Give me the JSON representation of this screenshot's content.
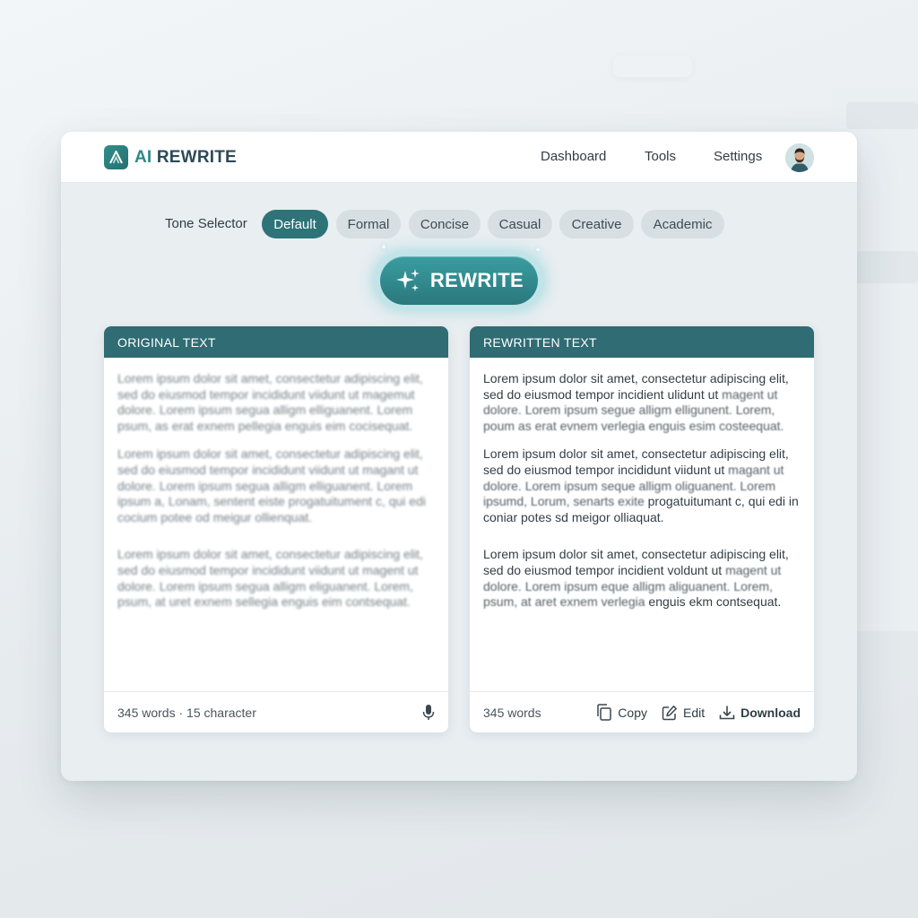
{
  "app": {
    "brand_ai": "AI",
    "brand_name": "REWRITE"
  },
  "nav": {
    "dashboard": "Dashboard",
    "tools": "Tools",
    "settings": "Settings"
  },
  "tone": {
    "label": "Tone Selector",
    "options": [
      "Default",
      "Formal",
      "Concise",
      "Casual",
      "Creative",
      "Academic"
    ],
    "selected": "Default"
  },
  "action": {
    "rewrite_label": "REWRITE"
  },
  "original": {
    "header": "ORIGINAL TEXT",
    "paragraphs": [
      "Lorem ipsum dolor sit amet, consectetur adipiscing elit, sed do eiusmod tempor incididunt viidunt ut magemut dolore. Lorem ipsum segua alligm elliguanent. Lorem psum, as erat exnem pellegia enguis eim cocisequat.",
      "Lorem ipsum dolor sit amet, consectetur adipiscing elit, sed do eiusmod tempor incididunt viidunt ut magant ut dolore. Lorem ipsum segua alligm elliguanent. Lorem ipsum a, Lonam, sentent eiste progatuitument c, qui edi cocium potee od meigur ollienquat.",
      "Lorem ipsum dolor sit amet, consectetur adipiscing elit, sed do eiusmod tempor incididunt viidunt ut magent ut dolore. Lorem ipsum segua alligm eliguanent. Lorem, psum, at uret exnem sellegia enguis eim contsequat."
    ],
    "stats": "345 words · 15 character"
  },
  "rewritten": {
    "header": "REWRITTEN TEXT",
    "paragraphs": [
      {
        "clear": "Lorem ipsum dolor sit amet, consectetur adipiscing elit, sed do eiusmod tempor incidient ulidunt ut",
        "fuzzy": "magent ut dolore. Lorem ipsum segue alligm elligunent. Lorem, poum as erat evnem verlegia",
        "tail": "enguis esim costeequat."
      },
      {
        "clear": "Lorem ipsum dolor sit amet, consectetur adipiscing elit, sed do eiusmod tempor incididunt viidunt ut",
        "fuzzy": "magant ut dolore. Lorem ipsum seque alligm oliguanent. Lorem ipsumd, Lorum, senarts exite",
        "tail": "progatuitumant c, qui edi in coniar potes sd meigor olliaquat."
      },
      {
        "clear": "Lorem ipsum dolor sit amet, consectetur adipiscing elit, sed do eiusmod tempor incidient voldunt ut",
        "fuzzy": "magent ut dolore. Lorem ipsum eque alligm aliguanent. Lorem, psum, at aret exnem verlegia",
        "tail": "enguis ekm contsequat."
      }
    ],
    "stats": "345 words",
    "copy_label": "Copy",
    "edit_label": "Edit",
    "download_label": "Download"
  },
  "icons": {
    "logo": "logo-mark-icon",
    "sparkle": "sparkle-icon",
    "mic": "microphone-icon",
    "copy": "copy-icon",
    "edit": "edit-icon",
    "download": "download-icon",
    "avatar": "user-avatar"
  },
  "colors": {
    "accent": "#2d7378",
    "header": "#2f6c74",
    "button": "#2a8a8d"
  }
}
